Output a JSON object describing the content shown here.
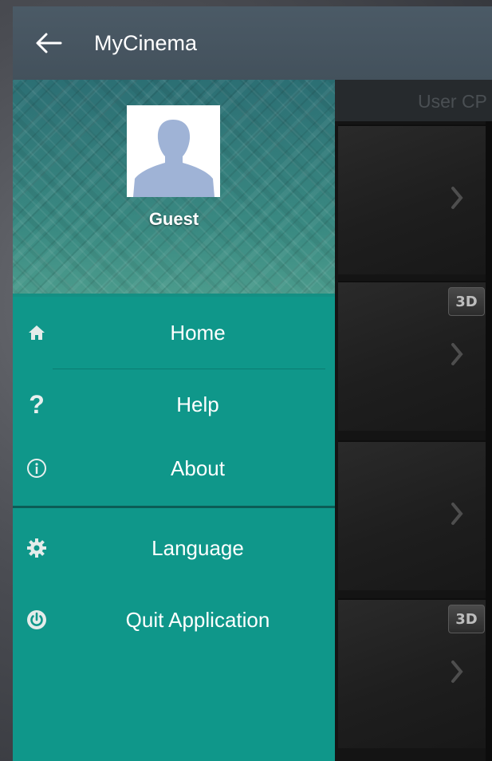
{
  "app": {
    "title": "MyCinema"
  },
  "drawer": {
    "user": {
      "name": "Guest"
    },
    "menu_primary": [
      {
        "label": "Home",
        "icon": "home-icon"
      },
      {
        "label": "Help",
        "icon": "question-icon"
      },
      {
        "label": "About",
        "icon": "info-icon"
      }
    ],
    "menu_secondary": [
      {
        "label": "Language",
        "icon": "gear-icon"
      },
      {
        "label": "Quit Application",
        "icon": "power-icon"
      }
    ]
  },
  "content": {
    "tab_label": "User CP",
    "badge_3d": "3D"
  },
  "colors": {
    "appbar": "#4b5a66",
    "drawer": "#0f978a",
    "drawer_divider": "#0b5d56"
  }
}
